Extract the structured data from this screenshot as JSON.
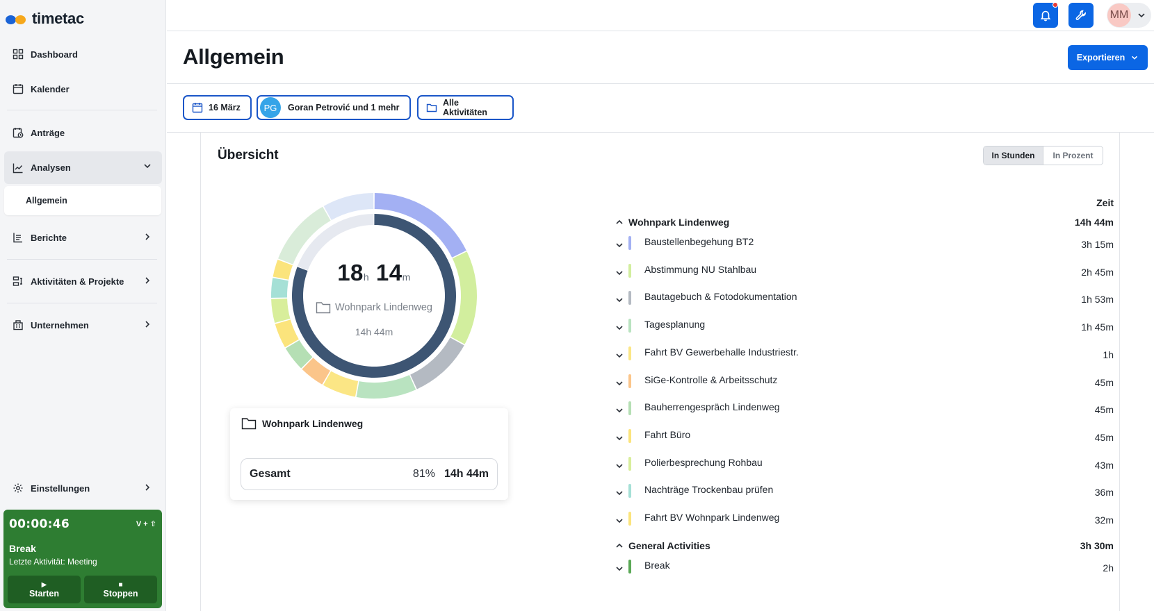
{
  "app": {
    "name": "timetac"
  },
  "sidebar": {
    "items": [
      {
        "label": "Dashboard"
      },
      {
        "label": "Kalender"
      },
      {
        "label": "Anträge"
      },
      {
        "label": "Analysen"
      },
      {
        "label": "Berichte"
      },
      {
        "label": "Aktivitäten & Projekte"
      },
      {
        "label": "Unternehmen"
      },
      {
        "label": "Einstellungen"
      }
    ],
    "sub_item": "Allgemein"
  },
  "timer": {
    "time": "00:00:46",
    "shortcut": "V + ⇧",
    "title": "Break",
    "last_activity": "Letzte Aktivität: Meeting",
    "start_label": "Starten",
    "stop_label": "Stoppen"
  },
  "topbar": {
    "user_initials": "MM",
    "notification_dot_color": "#e53935"
  },
  "page": {
    "title": "Allgemein",
    "export_label": "Exportieren"
  },
  "filters": {
    "date": "16 März",
    "person_initials": "PG",
    "persons": "Goran Petrović und 1 mehr",
    "activities": "Alle Aktivitäten"
  },
  "overview": {
    "title": "Übersicht",
    "toggle": {
      "option_hours": "In Stunden",
      "option_percent": "In Prozent",
      "selected": "In Stunden"
    },
    "center": {
      "hours": "18",
      "hours_unit": "h",
      "minutes": "14",
      "minutes_unit": "m",
      "project": "Wohnpark Lindenweg",
      "project_time": "14h 44m"
    },
    "tooltip": {
      "project": "Wohnpark Lindenweg",
      "total_label": "Gesamt",
      "percent": "81%",
      "total": "14h 44m"
    },
    "column_header": "Zeit",
    "groups": [
      {
        "name": "Wohnpark Lindenweg",
        "total": "14h 44m",
        "activities": [
          {
            "name": "Baustellenbegehung BT2",
            "time": "3h 15m",
            "color": "#a3b0f3"
          },
          {
            "name": "Abstimmung NU Stahlbau",
            "time": "2h 45m",
            "color": "#d2ee9e"
          },
          {
            "name": "Bautagebuch & Fotodokumentation",
            "time": "1h 53m",
            "color": "#b4bac2"
          },
          {
            "name": "Tagesplanung",
            "time": "1h 45m",
            "color": "#b9e3c0"
          },
          {
            "name": "Fahrt BV Gewerbehalle Industriestr.",
            "time": "1h",
            "color": "#fbe685"
          },
          {
            "name": "SiGe-Kontrolle & Arbeitsschutz",
            "time": "45m",
            "color": "#fbc58a"
          },
          {
            "name": "Bauherrengespräch Lindenweg",
            "time": "45m",
            "color": "#b5dfb4"
          },
          {
            "name": "Fahrt Büro",
            "time": "45m",
            "color": "#fbe47c"
          },
          {
            "name": "Polierbesprechung Rohbau",
            "time": "43m",
            "color": "#d8ee9b"
          },
          {
            "name": "Nachträge Trockenbau prüfen",
            "time": "36m",
            "color": "#a5e0d6"
          },
          {
            "name": "Fahrt BV Wohnpark Lindenweg",
            "time": "32m",
            "color": "#fbe47c"
          }
        ]
      },
      {
        "name": "General Activities",
        "total": "3h 30m",
        "activities": [
          {
            "name": "Break",
            "time": "2h",
            "color": "#5aa856"
          }
        ]
      }
    ],
    "donut": {
      "inner": [
        {
          "label": "Wohnpark Lindenweg",
          "minutes": 884,
          "color": "#3d5573"
        },
        {
          "label": "General Activities",
          "minutes": 210,
          "color": "#e6e9f0"
        }
      ],
      "outer": [
        {
          "minutes": 195,
          "color": "#a3b0f3"
        },
        {
          "minutes": 165,
          "color": "#d2ee9e"
        },
        {
          "minutes": 113,
          "color": "#b4bac2"
        },
        {
          "minutes": 105,
          "color": "#b9e3c0"
        },
        {
          "minutes": 60,
          "color": "#fbe685"
        },
        {
          "minutes": 45,
          "color": "#fbc58a"
        },
        {
          "minutes": 45,
          "color": "#b5dfb4"
        },
        {
          "minutes": 45,
          "color": "#fbe47c"
        },
        {
          "minutes": 43,
          "color": "#d8ee9b"
        },
        {
          "minutes": 36,
          "color": "#a5e0d6"
        },
        {
          "minutes": 32,
          "color": "#fbe47c"
        },
        {
          "minutes": 120,
          "color": "#d9ecd9"
        },
        {
          "minutes": 90,
          "color": "#dde6f7"
        }
      ]
    }
  },
  "colors": {
    "primary": "#0b66e4",
    "timer_green": "#2e7d32"
  }
}
